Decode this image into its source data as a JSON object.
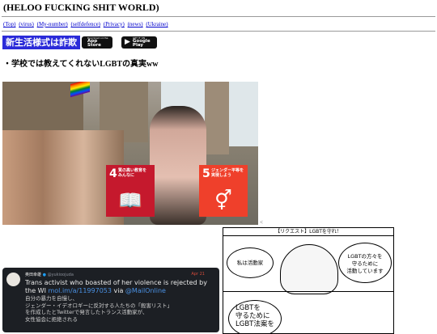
{
  "site": {
    "title": "(HELOO FUCKING SHIT WORLD)",
    "nav": [
      "(Top)",
      "(virus)",
      "(My-number)",
      "(selfdefence)",
      "(Privacy)",
      "(news)",
      "(Ukraine)"
    ]
  },
  "banner": {
    "text": "新生活様式は詐欺",
    "appstore_small": "Download on the",
    "appstore_big": "App Store",
    "googleplay_small": "GET IT ON",
    "googleplay_big": "Google Play"
  },
  "article": {
    "heading": "・学校では教えてくれないLGBTの真実ww"
  },
  "sdg": [
    {
      "num": "4",
      "label": "質の高い教育を\nみんなに",
      "color": "#c5192d",
      "icon": "book-icon"
    },
    {
      "num": "5",
      "label": "ジェンダー平等を\n実現しよう",
      "color": "#ef402b",
      "icon": "gender-icon"
    }
  ],
  "tweet": {
    "name": "奥田幸雄",
    "handle": "@yukioojuda",
    "date": "Apr 21",
    "body_pre": "Trans activist who boasted of her violence is rejected by the WI ",
    "link1": "mol.im/a/11997053",
    "via": " via ",
    "link2": "@MailOnline",
    "jp_lines": [
      "自分の暴力を自慢し、",
      "ジェンダー・イデオロギーに反対する人たちの「殺害リスト」",
      "を作成したとTwitterで発言したトランス活動家が、",
      "女性協会に拒絶される"
    ]
  },
  "manga": {
    "header": "【リクエスト】LGBTを守れ！",
    "b1": "私は活動家",
    "b2": "LGBTの方々を\n守るために\n活動しています",
    "b3": "LGBTを\n守るために\nLGBT法案を"
  },
  "caret": "<"
}
